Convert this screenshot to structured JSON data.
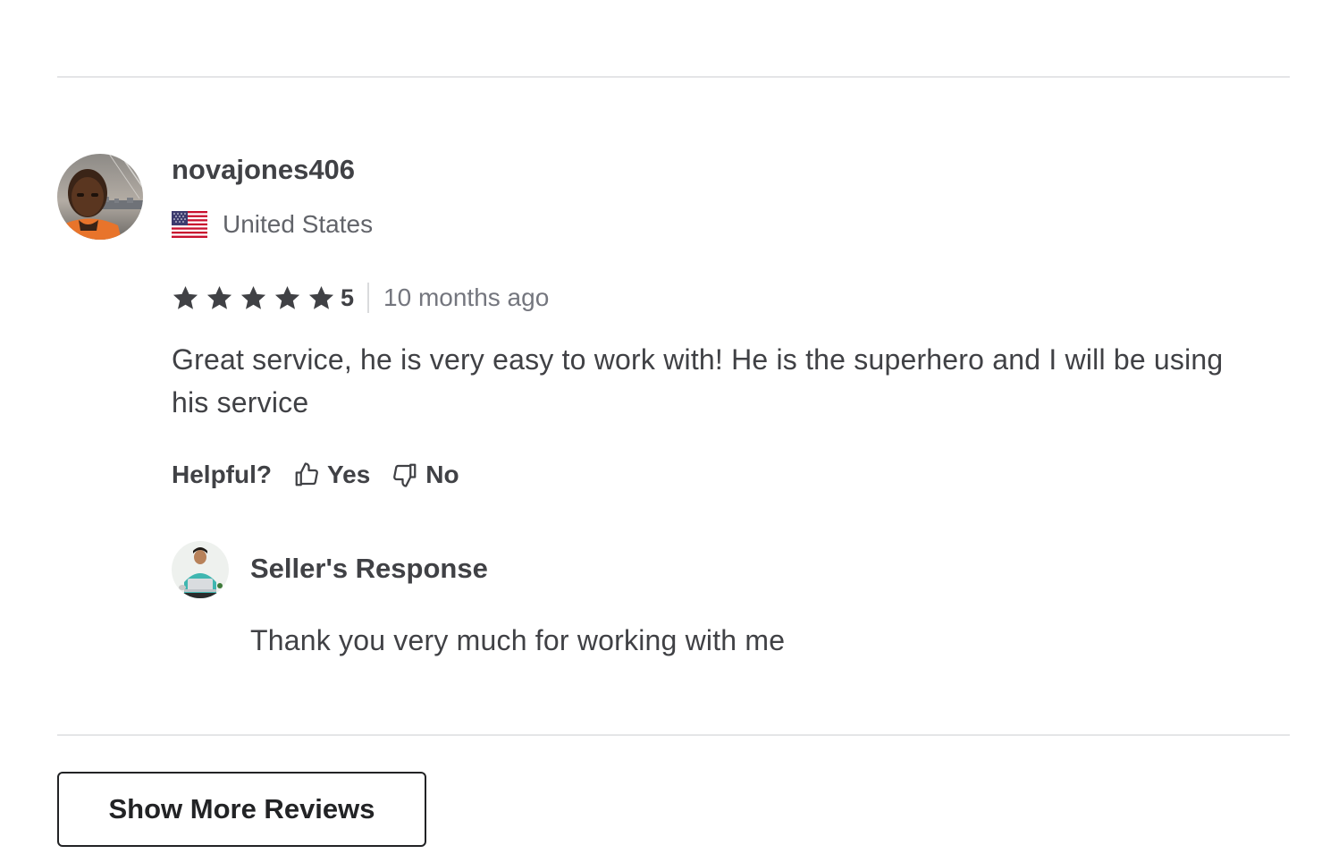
{
  "review": {
    "username": "novajones406",
    "avatar_icon": "reviewer-avatar-photo",
    "country": "United States",
    "flag_icon": "us-flag-icon",
    "rating": 5,
    "rating_label": "5",
    "date": "10 months ago",
    "text": "Great service, he is very easy to work with! He is the superhero and I will be using his service",
    "helpful": {
      "label": "Helpful?",
      "yes_label": "Yes",
      "no_label": "No"
    },
    "seller_response": {
      "title": "Seller's Response",
      "text": "Thank you very much for working with me",
      "avatar_icon": "seller-avatar-photo"
    }
  },
  "show_more_label": "Show More Reviews",
  "colors": {
    "text_primary": "#404145",
    "text_secondary": "#62646a",
    "star": "#404145",
    "divider": "#e4e5e7",
    "button_border": "#222325"
  }
}
